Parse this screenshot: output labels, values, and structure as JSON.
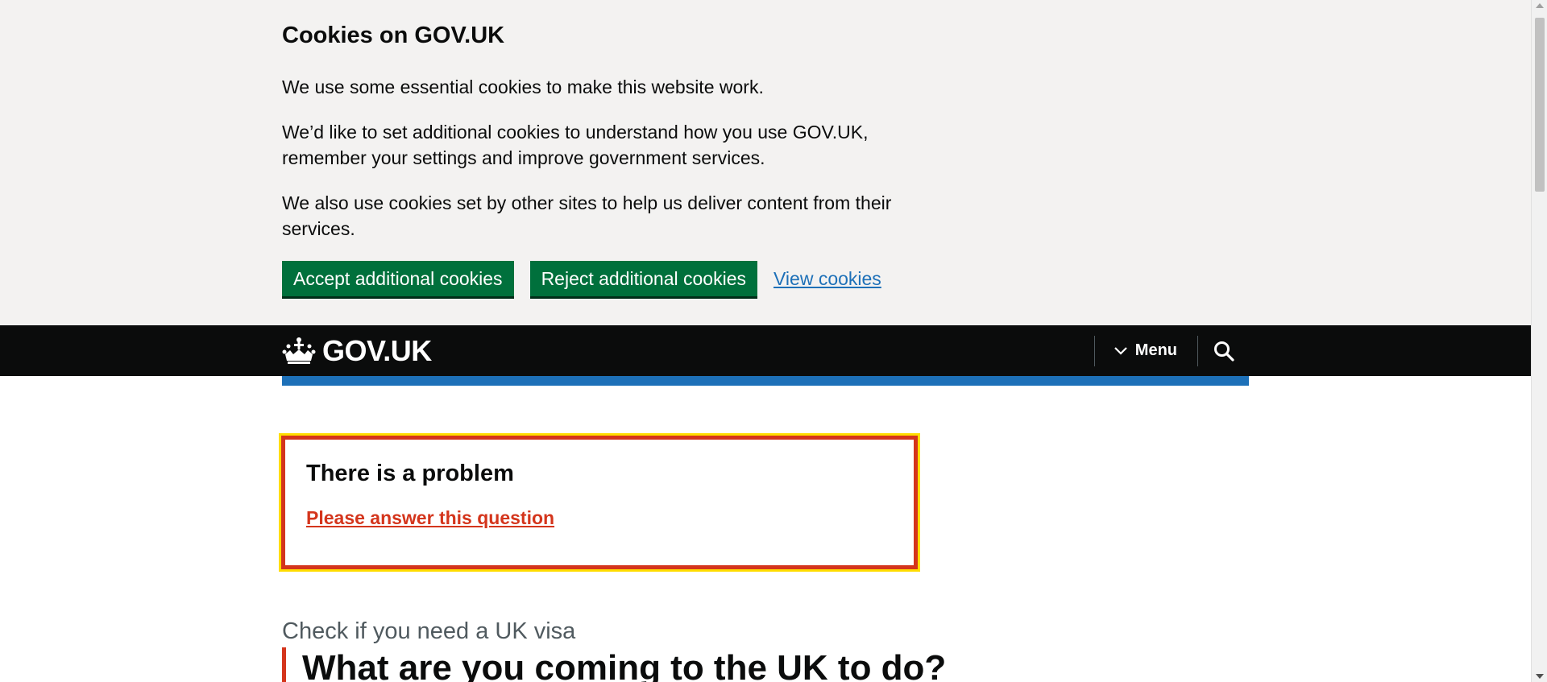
{
  "cookie_banner": {
    "title": "Cookies on GOV.UK",
    "paragraphs": [
      "We use some essential cookies to make this website work.",
      "We’d like to set additional cookies to understand how you use GOV.UK, remember your settings and improve government services.",
      "We also use cookies set by other sites to help us deliver content from their services."
    ],
    "accept_label": "Accept additional cookies",
    "reject_label": "Reject additional cookies",
    "view_label": "View cookies"
  },
  "header": {
    "logo_text": "GOV.UK",
    "menu_label": "Menu",
    "search_icon": "search-icon",
    "menu_icon": "chevron-down-icon",
    "logo_icon": "crown-icon"
  },
  "error_summary": {
    "title": "There is a problem",
    "link": "Please answer this question"
  },
  "question": {
    "caption": "Check if you need a UK visa",
    "title": "What are you coming to the UK to do?"
  },
  "colors": {
    "banner_bg": "#f3f2f1",
    "button_green": "#00703c",
    "link_blue": "#1d70b8",
    "header_black": "#0b0c0c",
    "error_red": "#d4351c",
    "focus_yellow": "#ffdd00"
  }
}
